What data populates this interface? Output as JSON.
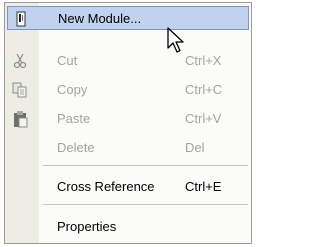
{
  "context_menu": {
    "items": [
      {
        "label": "New Module...",
        "shortcut": "",
        "enabled": true,
        "highlighted": true,
        "icon": "module-icon"
      },
      {
        "label": "Cut",
        "shortcut": "Ctrl+X",
        "enabled": false,
        "icon": "scissors-icon"
      },
      {
        "label": "Copy",
        "shortcut": "Ctrl+C",
        "enabled": false,
        "icon": "copy-icon"
      },
      {
        "label": "Paste",
        "shortcut": "Ctrl+V",
        "enabled": false,
        "icon": "clipboard-icon"
      },
      {
        "label": "Delete",
        "shortcut": "Del",
        "enabled": false
      },
      {
        "label": "Cross Reference",
        "shortcut": "Ctrl+E",
        "enabled": true
      },
      {
        "label": "Properties",
        "shortcut": "",
        "enabled": true
      }
    ]
  },
  "colors": {
    "highlight_bg": "#c1d2ee",
    "highlight_border": "#7a96c8",
    "gutter": "#eeede5",
    "disabled_text": "#a3a3a0"
  },
  "cursor": {
    "icon": "arrow-cursor-icon"
  }
}
